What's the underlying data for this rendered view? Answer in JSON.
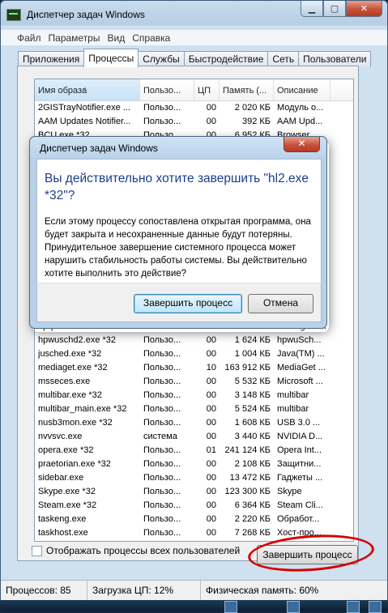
{
  "window": {
    "title": "Диспетчер задач Windows"
  },
  "menu": [
    "Файл",
    "Параметры",
    "Вид",
    "Справка"
  ],
  "tabs": [
    "Приложения",
    "Процессы",
    "Службы",
    "Быстродействие",
    "Сеть",
    "Пользователи"
  ],
  "active_tab": "Процессы",
  "columns": [
    "Имя образа",
    "Пользо...",
    "ЦП",
    "Память (...",
    "Описание"
  ],
  "rows_top": [
    [
      "2GISTrayNotifier.exe ...",
      "Пользо...",
      "00",
      "2 020 КБ",
      "Модуль о..."
    ],
    [
      "AAM Updates Notifier...",
      "Пользо...",
      "00",
      "392 КБ",
      "AAM Upd..."
    ],
    [
      "BCU.exe *32",
      "Пользо...",
      "00",
      "6 952 КБ",
      "Browser ..."
    ]
  ],
  "rows_bottom": [
    [
      "hpqtra08.exe *32",
      "Пользо...",
      "00",
      "6 488 КБ",
      "HP Digital ..."
    ],
    [
      "hpwuschd2.exe *32",
      "Пользо...",
      "00",
      "1 624 КБ",
      "hpwuSch..."
    ],
    [
      "jusched.exe *32",
      "Пользо...",
      "00",
      "1 004 КБ",
      "Java(TM) ..."
    ],
    [
      "mediaget.exe *32",
      "Пользо...",
      "10",
      "163 912 КБ",
      "MediaGet ..."
    ],
    [
      "msseces.exe",
      "Пользо...",
      "00",
      "5 532 КБ",
      "Microsoft ..."
    ],
    [
      "multibar.exe *32",
      "Пользо...",
      "00",
      "3 148 КБ",
      "multibar"
    ],
    [
      "multibar_main.exe *32",
      "Пользо...",
      "00",
      "5 524 КБ",
      "multibar"
    ],
    [
      "nusb3mon.exe *32",
      "Пользо...",
      "00",
      "1 608 КБ",
      "USB 3.0 ..."
    ],
    [
      "nvvsvc.exe",
      "система",
      "00",
      "3 440 КБ",
      "NVIDIA D..."
    ],
    [
      "opera.exe *32",
      "Пользо...",
      "01",
      "241 124 КБ",
      "Opera Int..."
    ],
    [
      "praetorian.exe *32",
      "Пользо...",
      "00",
      "2 108 КБ",
      "Защитни..."
    ],
    [
      "sidebar.exe",
      "Пользо...",
      "00",
      "13 472 КБ",
      "Гаджеты ..."
    ],
    [
      "Skype.exe *32",
      "Пользо...",
      "00",
      "123 300 КБ",
      "Skype"
    ],
    [
      "Steam.exe *32",
      "Пользо...",
      "00",
      "6 364 КБ",
      "Steam Cli..."
    ],
    [
      "taskeng.exe",
      "Пользо...",
      "00",
      "2 220 КБ",
      "Обработ..."
    ],
    [
      "taskhost.exe",
      "Пользо...",
      "00",
      "7 268 КБ",
      "Хост-про..."
    ]
  ],
  "show_all_label": "Отображать процессы всех пользователей",
  "end_process_button": "Завершить процесс",
  "status": {
    "processes": "Процессов: 85",
    "cpu": "Загрузка ЦП: 12%",
    "memory": "Физическая память: 60%"
  },
  "dialog": {
    "title": "Диспетчер задач Windows",
    "heading": "Вы действительно хотите завершить \"hl2.exe *32\"?",
    "text": "Если этому процессу сопоставлена открытая программа, она будет закрыта и несохраненные данные будут потеряны. Принудительное завершение системного процесса может нарушить стабильность работы системы. Вы действительно хотите выполнить это действие?",
    "confirm_button": "Завершить процесс",
    "cancel_button": "Отмена"
  },
  "icons": [
    "app-icon",
    "minimize-icon",
    "maximize-icon",
    "close-icon",
    "sort-up-icon",
    "checkbox-icon"
  ]
}
